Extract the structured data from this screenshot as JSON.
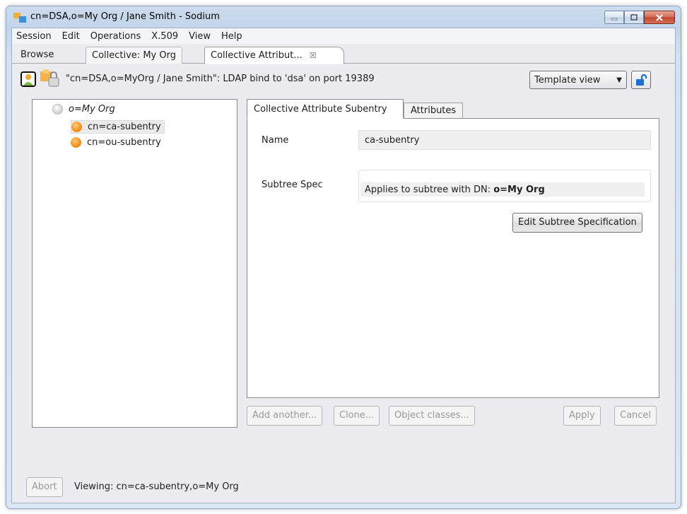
{
  "window": {
    "title": "cn=DSA,o=My Org / Jane Smith - Sodium"
  },
  "menu": [
    "Session",
    "Edit",
    "Operations",
    "X.509",
    "View",
    "Help"
  ],
  "tabs": [
    {
      "label": "Browse"
    },
    {
      "label": "Collective: My Org"
    },
    {
      "label": "Collective Attribut...",
      "close": "☒"
    }
  ],
  "connection": {
    "text": "\"cn=DSA,o=MyOrg / Jane Smith\": LDAP bind to 'dsa' on port 19389"
  },
  "view_select": {
    "value": "Template view"
  },
  "tree": {
    "root": "o=My Org",
    "children": [
      "cn=ca-subentry",
      "cn=ou-subentry"
    ]
  },
  "editor": {
    "tabs": [
      "Collective Attribute Subentry",
      "Attributes"
    ],
    "name_label": "Name",
    "name_value": "ca-subentry",
    "subtree_label": "Subtree Spec",
    "subtree_prefix": "Applies to subtree with DN: ",
    "subtree_dn": "o=My Org",
    "edit_button": "Edit Subtree Specification"
  },
  "actions": {
    "add_another": "Add another...",
    "clone": "Clone...",
    "object_classes": "Object classes...",
    "apply": "Apply",
    "cancel": "Cancel"
  },
  "status": {
    "abort": "Abort",
    "text": "Viewing: cn=ca-subentry,o=My Org"
  },
  "colors": {
    "accent": "#1a6fd0",
    "node_orange": "#f0911b",
    "close_red": "#c1452c"
  }
}
